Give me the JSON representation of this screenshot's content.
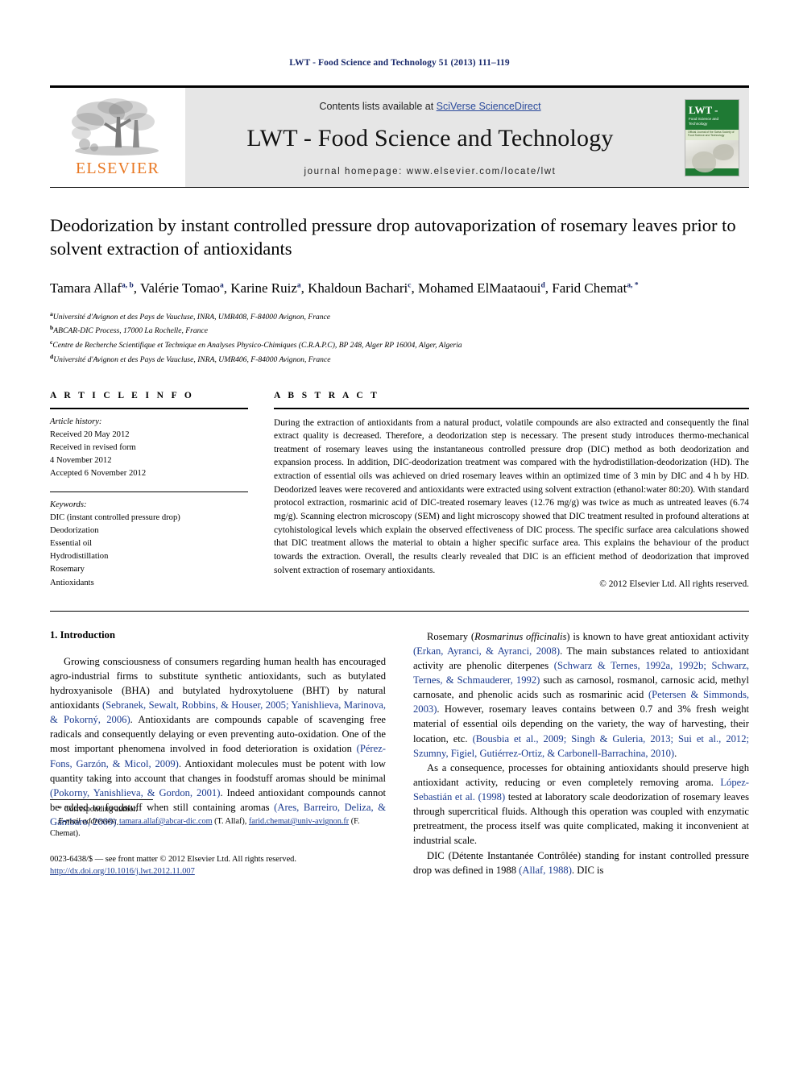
{
  "running_head": "LWT - Food Science and Technology 51 (2013) 111–119",
  "masthead": {
    "publisher_name": "ELSEVIER",
    "contents_prefix": "Contents lists available at ",
    "contents_link": "SciVerse ScienceDirect",
    "journal_title": "LWT - Food Science and Technology",
    "homepage": "journal homepage: www.elsevier.com/locate/lwt",
    "cover": {
      "title": "LWT -",
      "subtitle": "Food Science and Technology",
      "band_text": "Official Journal of the Swiss Society of Food Science and Technology"
    }
  },
  "article": {
    "title": "Deodorization by instant controlled pressure drop autovaporization of rosemary leaves prior to solvent extraction of antioxidants",
    "authors": [
      {
        "name": "Tamara Allaf",
        "marks": "a, b"
      },
      {
        "name": "Valérie Tomao",
        "marks": "a"
      },
      {
        "name": "Karine Ruiz",
        "marks": "a"
      },
      {
        "name": "Khaldoun Bachari",
        "marks": "c"
      },
      {
        "name": "Mohamed ElMaataoui",
        "marks": "d"
      },
      {
        "name": "Farid Chemat",
        "marks": "a, *"
      }
    ],
    "affiliations": [
      {
        "mark": "a",
        "text": "Université d'Avignon et des Pays de Vaucluse, INRA, UMR408, F-84000 Avignon, France"
      },
      {
        "mark": "b",
        "text": "ABCAR-DIC Process, 17000 La Rochelle, France"
      },
      {
        "mark": "c",
        "text": "Centre de Recherche Scientifique et Technique en Analyses Physico-Chimiques (C.R.A.P.C), BP 248, Alger RP 16004, Alger, Algeria"
      },
      {
        "mark": "d",
        "text": "Université d'Avignon et des Pays de Vaucluse, INRA, UMR406, F-84000 Avignon, France"
      }
    ]
  },
  "article_info": {
    "heading": "A R T I C L E   I N F O",
    "history_label": "Article history:",
    "history": [
      "Received 20 May 2012",
      "Received in revised form",
      "4 November 2012",
      "Accepted 6 November 2012"
    ],
    "keywords_label": "Keywords:",
    "keywords": [
      "DIC (instant controlled pressure drop)",
      "Deodorization",
      "Essential oil",
      "Hydrodistillation",
      "Rosemary",
      "Antioxidants"
    ]
  },
  "abstract": {
    "heading": "A B S T R A C T",
    "text": "During the extraction of antioxidants from a natural product, volatile compounds are also extracted and consequently the final extract quality is decreased. Therefore, a deodorization step is necessary. The present study introduces thermo-mechanical treatment of rosemary leaves using the instantaneous controlled pressure drop (DIC) method as both deodorization and expansion process. In addition, DIC-deodorization treatment was compared with the hydrodistillation-deodorization (HD). The extraction of essential oils was achieved on dried rosemary leaves within an optimized time of 3 min by DIC and 4 h by HD. Deodorized leaves were recovered and antioxidants were extracted using solvent extraction (ethanol:water 80:20). With standard protocol extraction, rosmarinic acid of DIC-treated rosemary leaves (12.76 mg/g) was twice as much as untreated leaves (6.74 mg/g). Scanning electron microscopy (SEM) and light microscopy showed that DIC treatment resulted in profound alterations at cytohistological levels which explain the observed effectiveness of DIC process. The specific surface area calculations showed that DIC treatment allows the material to obtain a higher specific surface area. This explains the behaviour of the product towards the extraction. Overall, the results clearly revealed that DIC is an efficient method of deodorization that improved solvent extraction of rosemary antioxidants.",
    "copyright": "© 2012 Elsevier Ltd. All rights reserved."
  },
  "body": {
    "section_number_title": "1.  Introduction",
    "left_paragraphs": [
      "Growing consciousness of consumers regarding human health has encouraged agro-industrial firms to substitute synthetic antioxidants, such as butylated hydroxyanisole (BHA) and butylated hydroxytoluene (BHT) by natural antioxidants (Sebranek, Sewalt, Robbins, & Houser, 2005; Yanishlieva, Marinova, & Pokorný, 2006). Antioxidants are compounds capable of scavenging free radicals and consequently delaying or even preventing auto-oxidation. One of the most important phenomena involved in food deterioration is oxidation (Pérez-Fons, Garzón, & Micol, 2009). Antioxidant molecules must be potent with low quantity taking into account that changes in foodstuff aromas should be minimal (Pokorny, Yanishlieva, & Gordon, 2001). Indeed antioxidant compounds cannot be added to foodstuff when still containing aromas (Ares, Barreiro, Deliza, & Gámbaro, 2009)."
    ],
    "right_paragraphs": [
      "Rosemary (Rosmarinus officinalis) is known to have great antioxidant activity (Erkan, Ayranci, & Ayranci, 2008). The main substances related to antioxidant activity are phenolic diterpenes (Schwarz & Ternes, 1992a, 1992b; Schwarz, Ternes, & Schmauderer, 1992) such as carnosol, rosmanol, carnosic acid, methyl carnosate, and phenolic acids such as rosmarinic acid (Petersen & Simmonds, 2003). However, rosemary leaves contains between 0.7 and 3% fresh weight material of essential oils depending on the variety, the way of harvesting, their location, etc. (Bousbia et al., 2009; Singh & Guleria, 2013; Sui et al., 2012; Szumny, Figiel, Gutiérrez-Ortiz, & Carbonell-Barrachina, 2010).",
      "As a consequence, processes for obtaining antioxidants should preserve high antioxidant activity, reducing or even completely removing aroma. López-Sebastián et al. (1998) tested at laboratory scale deodorization of rosemary leaves through supercritical fluids. Although this operation was coupled with enzymatic pretreatment, the process itself was quite complicated, making it inconvenient at industrial scale.",
      "DIC (Détente Instantanée Contrôlée) standing for instant controlled pressure drop was defined in 1988 (Allaf, 1988). DIC is"
    ]
  },
  "footnotes": {
    "corresponding": "* Corresponding author.",
    "email_label": "E-mail addresses:",
    "email1": "tamara.allaf@abcar-dic.com",
    "email1_owner": "(T. Allaf),",
    "email2": "farid.chemat@univ-avignon.fr",
    "email2_owner": "(F. Chemat).",
    "issn_line": "0023-6438/$ — see front matter © 2012 Elsevier Ltd. All rights reserved.",
    "doi": "http://dx.doi.org/10.1016/j.lwt.2012.11.007"
  }
}
